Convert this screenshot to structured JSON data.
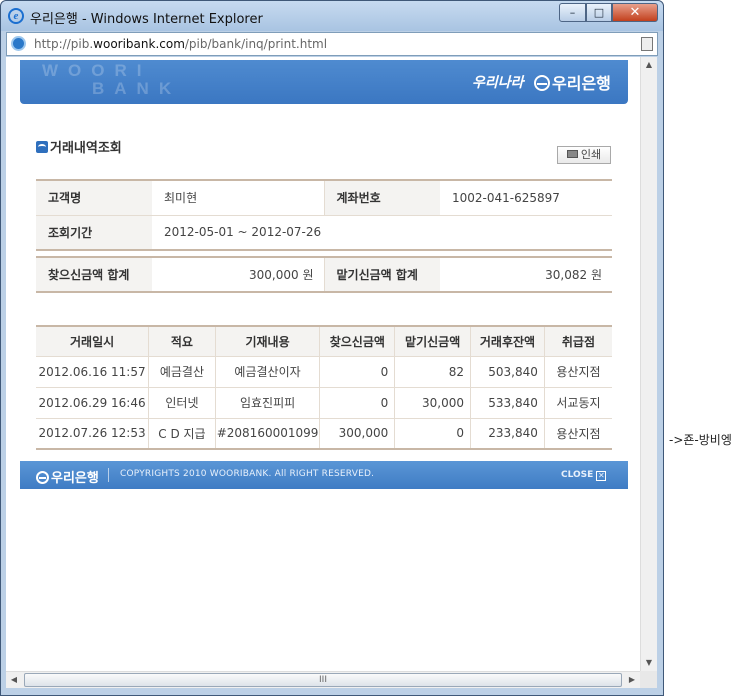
{
  "window": {
    "title": "우리은행 - Windows Internet Explorer",
    "buttons": {
      "minimize": "–",
      "maximize": "□",
      "close": "✕"
    },
    "url_prefix": "http://pib.",
    "url_domain": "wooribank.com",
    "url_path": "/pib/bank/inq/print.html"
  },
  "banner": {
    "watermark_line1": "WOORI",
    "watermark_line2": "BANK",
    "slogan": "우리나라",
    "logo": "우리은행"
  },
  "section": {
    "title": "거래내역조회",
    "print_label": "인쇄"
  },
  "info": {
    "customer_label": "고객명",
    "customer_value": "최미현",
    "account_label": "계좌번호",
    "account_value": "1002-041-625897",
    "period_label": "조회기간",
    "period_value": "2012-05-01 ~ 2012-07-26"
  },
  "summary": {
    "withdraw_label": "찾으신금액 합계",
    "withdraw_value": "300,000 원",
    "deposit_label": "맡기신금액 합계",
    "deposit_value": "30,082 원"
  },
  "transactions": {
    "headers": [
      "거래일시",
      "적요",
      "기재내용",
      "찾으신금액",
      "맡기신금액",
      "거래후잔액",
      "취급점"
    ],
    "rows": [
      [
        "2012.06.16 11:57",
        "예금결산",
        "예금결산이자",
        "0",
        "82",
        "503,840",
        "용산지점"
      ],
      [
        "2012.06.29 16:46",
        "인터넷",
        "임효진피피",
        "0",
        "30,000",
        "533,840",
        "서교동지"
      ],
      [
        "2012.07.26 12:53",
        "C D 지급",
        "#208160001099",
        "300,000",
        "0",
        "233,840",
        "용산지점"
      ]
    ]
  },
  "footer": {
    "logo": "우리은행",
    "copyright": "COPYRIGHTS 2010  WOORIBANK. All RIGHT RESERVED.",
    "close_label": "CLOSE",
    "close_icon": "✕"
  },
  "scrollbar": {
    "grip": "III",
    "up": "▲",
    "down": "▼",
    "left": "◀",
    "right": "▶"
  },
  "side_note": "->죤-방비엥"
}
